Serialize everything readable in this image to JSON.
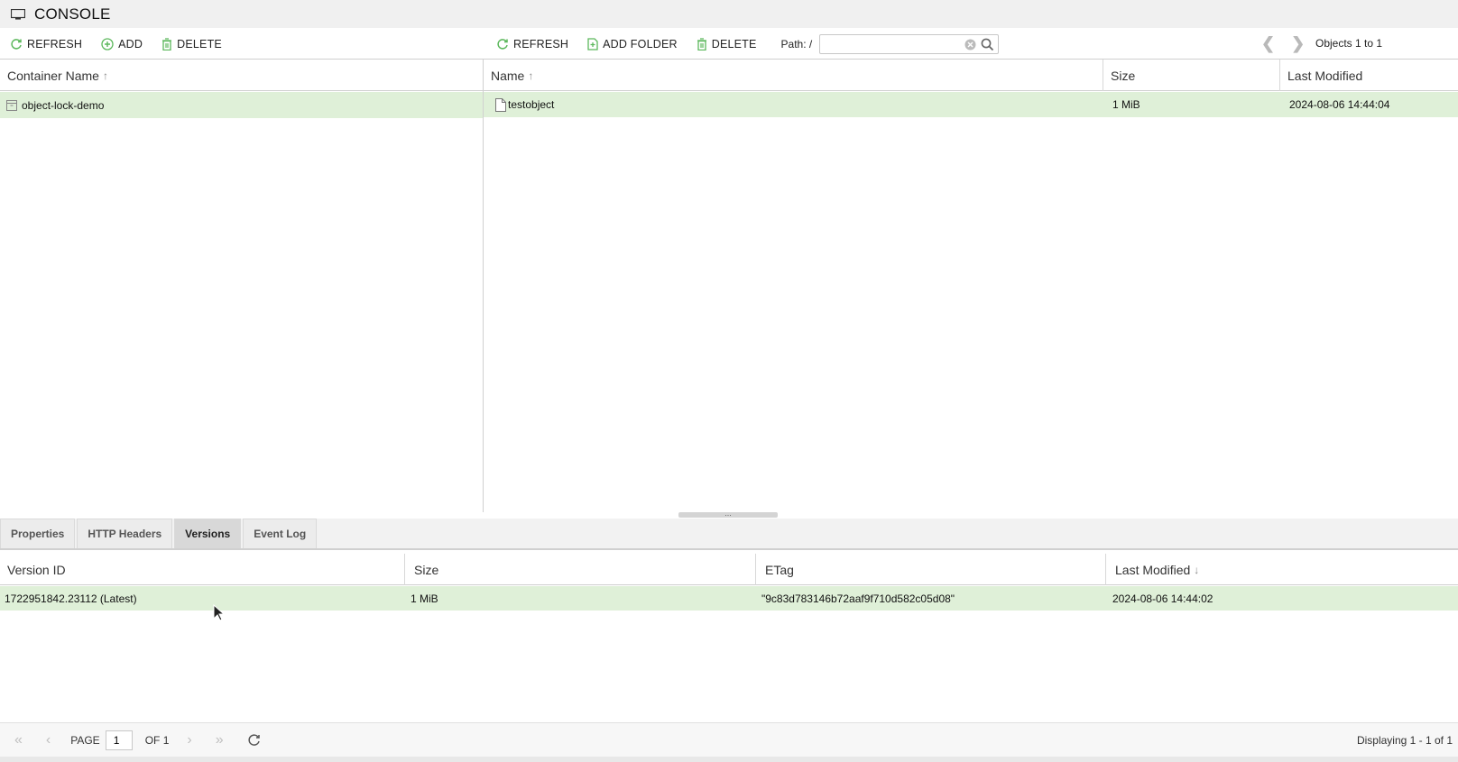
{
  "title": "CONSOLE",
  "left_toolbar": {
    "refresh": "REFRESH",
    "add": "ADD",
    "delete": "DELETE"
  },
  "right_toolbar": {
    "refresh": "REFRESH",
    "add_folder": "ADD FOLDER",
    "delete": "DELETE",
    "path_label": "Path: /",
    "path_value": ""
  },
  "nav": {
    "prev": "❮",
    "next": "❯",
    "objects_label": "Objects 1 to 1"
  },
  "containers": {
    "header": "Container Name",
    "rows": [
      {
        "name": "object-lock-demo"
      }
    ]
  },
  "objects": {
    "headers": {
      "name": "Name",
      "size": "Size",
      "modified": "Last Modified"
    },
    "rows": [
      {
        "name": "testobject",
        "size": "1 MiB",
        "modified": "2024-08-06 14:44:04"
      }
    ]
  },
  "tabs": [
    {
      "label": "Properties",
      "active": false
    },
    {
      "label": "HTTP Headers",
      "active": false
    },
    {
      "label": "Versions",
      "active": true
    },
    {
      "label": "Event Log",
      "active": false
    }
  ],
  "versions": {
    "headers": {
      "id": "Version ID",
      "size": "Size",
      "etag": "ETag",
      "modified": "Last Modified"
    },
    "rows": [
      {
        "id": "1722951842.23112 (Latest)",
        "size": "1 MiB",
        "etag": "\"9c83d783146b72aaf9f710d582c05d08\"",
        "modified": "2024-08-06 14:44:02"
      }
    ]
  },
  "pager": {
    "page_label": "PAGE",
    "page": "1",
    "of": "OF 1",
    "display": "Displaying 1 - 1 of 1"
  },
  "colors": {
    "accent": "#5cb85c",
    "selected_row": "#dff0d8"
  },
  "icons": {
    "refresh": "refresh-icon",
    "add": "plus-circle-icon",
    "delete": "trash-icon",
    "folder": "add-folder-icon",
    "search": "search-icon",
    "clear": "clear-icon",
    "file": "file-icon",
    "container": "container-icon",
    "monitor": "monitor-icon"
  }
}
